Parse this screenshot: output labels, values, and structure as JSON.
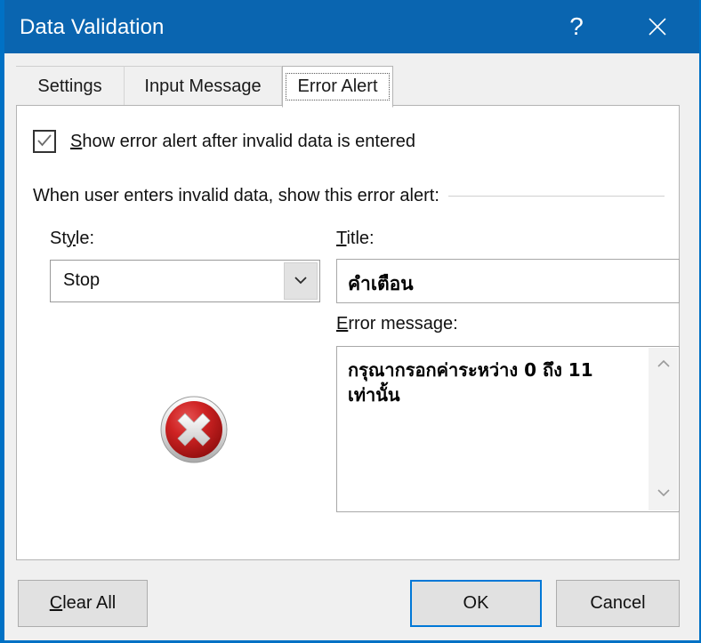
{
  "window": {
    "title": "Data Validation",
    "help_icon": "question-mark-icon",
    "close_icon": "close-icon",
    "accent_color": "#0a65b0",
    "focus_color": "#0078d7"
  },
  "tabs": [
    {
      "label": "Settings",
      "active": false
    },
    {
      "label": "Input Message",
      "active": false
    },
    {
      "label": "Error Alert",
      "active": true
    }
  ],
  "panel": {
    "checkbox": {
      "checked": true,
      "label_prefix": "",
      "accel": "S",
      "label_rest": "how error alert after invalid data is entered",
      "full_label": "Show error alert after invalid data is entered"
    },
    "group_header": "When user enters invalid data, show this error alert:",
    "style": {
      "accel": "y",
      "label_before": "St",
      "label_after": "le:",
      "label": "Style:",
      "value": "Stop",
      "dropdown_icon": "chevron-down-icon"
    },
    "error_icon": {
      "name": "stop-error-icon",
      "circle_color": "#c01a1a",
      "x_color": "#e8e8e8"
    },
    "title_field": {
      "accel": "T",
      "label_after": "itle:",
      "label": "Title:",
      "value": "คำเตือน"
    },
    "error_message_field": {
      "accel": "E",
      "label_after": "rror message:",
      "label": "Error message:",
      "value": "กรุณากรอกค่าระหว่าง 0 ถึง 11 เท่านั้น",
      "scroll_up_icon": "chevron-up-icon",
      "scroll_down_icon": "chevron-down-icon"
    }
  },
  "footer": {
    "clear_all": {
      "accel": "C",
      "label_after": "lear All",
      "label": "Clear All"
    },
    "ok": "OK",
    "cancel": "Cancel"
  }
}
